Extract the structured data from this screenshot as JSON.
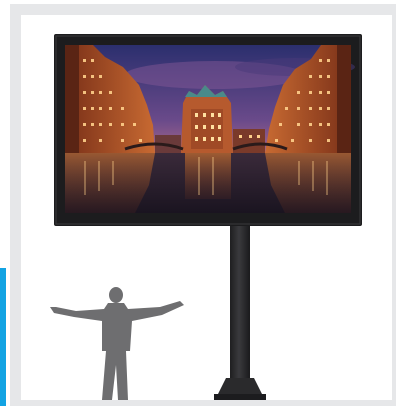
{
  "image": {
    "subject": "outdoor-display-on-pole",
    "scene": "night-canal-city-reflection",
    "colors": {
      "frame": "#e6e7e9",
      "accent": "#12a3e3",
      "bezel": "#1c1c1e",
      "post": "#2a2a2c",
      "person": "#6e6e70",
      "sky_top": "#2b2f6e",
      "sky_mid": "#7a4a8c",
      "sky_glow": "#c9778a",
      "building_warm": "#c9602e",
      "water": "#241a2a"
    }
  }
}
